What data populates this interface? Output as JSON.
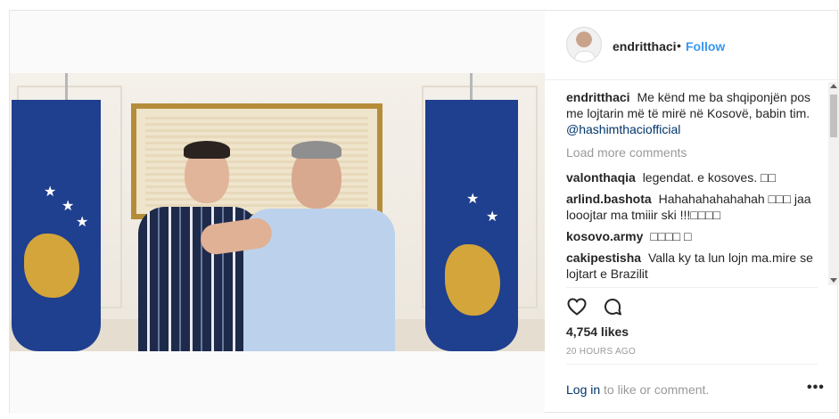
{
  "post": {
    "username": "endritthaci",
    "separator": "•",
    "follow_label": "Follow",
    "caption": {
      "username": "endritthaci",
      "text": "Me kënd me ba shqiponjën pos me lojtarin më të mirë në Kosovë, babin tim.",
      "mention": "@hashimthaciofficial"
    },
    "load_more_label": "Load more comments",
    "comments": [
      {
        "username": "valonthaqia",
        "text": "legendat. e kosoves. □□"
      },
      {
        "username": "arlind.bashota",
        "text": "Hahahahahahahah □□□ jaa looojtar ma tmiiir ski !!!□□□□"
      },
      {
        "username": "kosovo.army",
        "text": "□□□□ □"
      },
      {
        "username": "cakipestisha",
        "text": "Valla ky ta lun lojn ma.mire se lojtart e Brazilit"
      }
    ],
    "like_icon": "heart-icon",
    "comment_icon": "comment-bubble-icon",
    "likes_label": "4,754 likes",
    "timestamp": "20 HOURS AGO",
    "login_link": "Log in",
    "login_suffix": " to like or comment.",
    "more_label": "•••"
  },
  "colors": {
    "link": "#3897f0",
    "mention": "#003569",
    "muted": "#999999",
    "text": "#262626",
    "flag_blue": "#1f3f8f",
    "flag_gold": "#d3a53a"
  }
}
